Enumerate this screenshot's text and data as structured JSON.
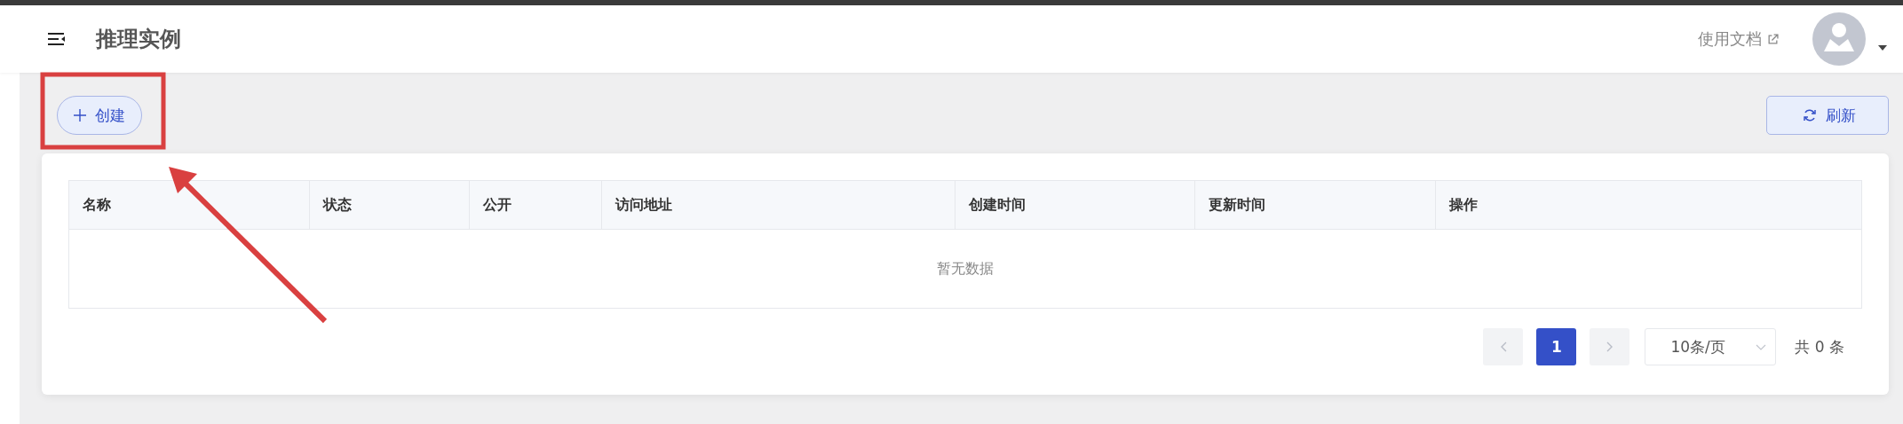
{
  "header": {
    "title": "推理实例",
    "docs_link": "使用文档"
  },
  "toolbar": {
    "create_button": "创建",
    "refresh_button": "刷新"
  },
  "table": {
    "columns": [
      "名称",
      "状态",
      "公开",
      "访问地址",
      "创建时间",
      "更新时间",
      "操作"
    ],
    "empty_text": "暂无数据"
  },
  "pagination": {
    "pages": [
      {
        "label": "1",
        "selected": true
      }
    ],
    "page_size": "10条/页",
    "total": "共 0 条"
  },
  "annotation": {
    "highlight_box": true,
    "arrow": true
  }
}
